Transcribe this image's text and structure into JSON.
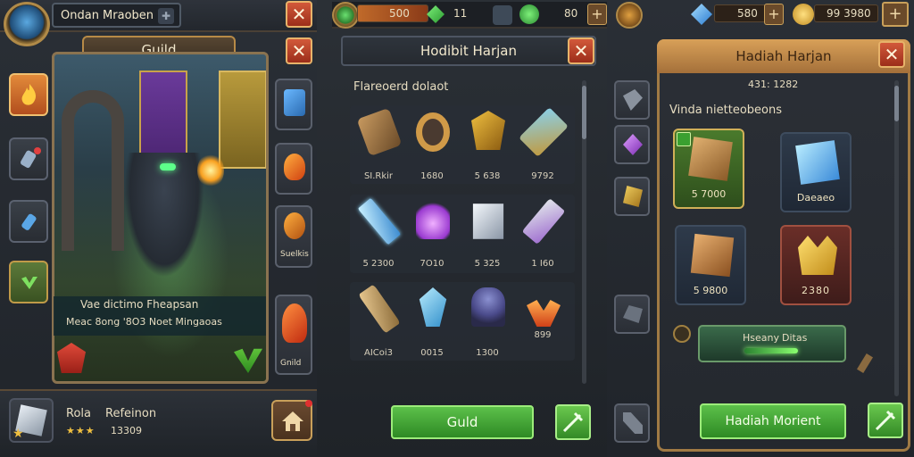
{
  "colors": {
    "gold": "#c99a3e",
    "green": "#4cb03a",
    "red": "#c0442a",
    "panel": "#2a2f36"
  },
  "col1": {
    "player_name": "Ondan Mraoben",
    "banner_title": "Guild",
    "scene_info_line1": "Vae dictimo Fheapsan",
    "scene_info_line2": "Meac 8ong '8O3 Noet Mingaoas",
    "right_rail": [
      {
        "label": "Suelkis"
      },
      {
        "label": "Gnild"
      }
    ],
    "footer": {
      "label_a": "Rola",
      "label_b": "Refeinon",
      "stars": "★★★",
      "value": "13309"
    }
  },
  "col2": {
    "resources": {
      "gold_value": "500",
      "mid_value": "11",
      "right_value": "80"
    },
    "title": "Hodibit Harjan",
    "section_label": "Flareoerd dolaot",
    "items_row1": [
      {
        "label": "SI.Rkir"
      },
      {
        "label": "1680"
      },
      {
        "label": "5 638"
      },
      {
        "label": "9792"
      }
    ],
    "items_row2": [
      {
        "label": "5 2300"
      },
      {
        "label": "7O10"
      },
      {
        "label": "5 325"
      },
      {
        "label": "1  I60"
      }
    ],
    "items_row3": [
      {
        "label": "AICoi3"
      },
      {
        "label": "0015"
      },
      {
        "label": "1300"
      },
      {
        "label": "899"
      }
    ],
    "guild_button": "Guld"
  },
  "col3": {
    "resources": {
      "gem_value": "580",
      "gold_value": "99 3980"
    },
    "title": "Hadiah Harjan",
    "subtitle": "431: 1282",
    "section_label": "Vinda nietteobeons",
    "cards": [
      {
        "val": "5 7000"
      },
      {
        "val": "Daeaeo"
      },
      {
        "val": "5 9800"
      },
      {
        "val": "2380"
      }
    ],
    "pill_label_1": "Hseany",
    "pill_label_2": "Ditas",
    "main_button": "Hadiah Morient"
  }
}
